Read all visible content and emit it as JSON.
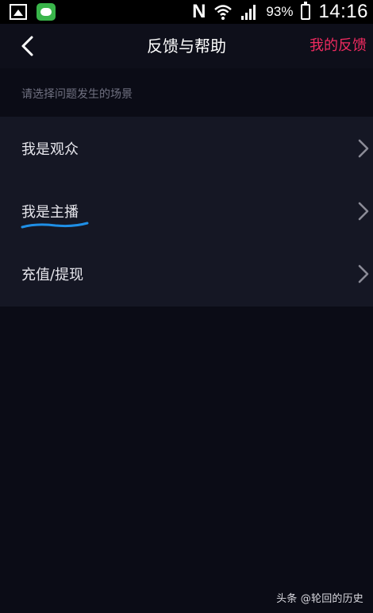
{
  "status_bar": {
    "battery_percent": "93%",
    "time": "14:16",
    "icons": [
      "image-icon",
      "app-icon",
      "nfc-icon",
      "wifi-icon",
      "signal-icon",
      "battery-icon"
    ]
  },
  "header": {
    "title": "反馈与帮助",
    "right_link": "我的反馈",
    "accent_color": "#ee2a5f"
  },
  "section": {
    "label": "请选择问题发生的场景"
  },
  "scenes": [
    {
      "label": "我是观众"
    },
    {
      "label": "我是主播"
    },
    {
      "label": "充值/提现"
    }
  ],
  "watermark": "头条 @轮回的历史"
}
